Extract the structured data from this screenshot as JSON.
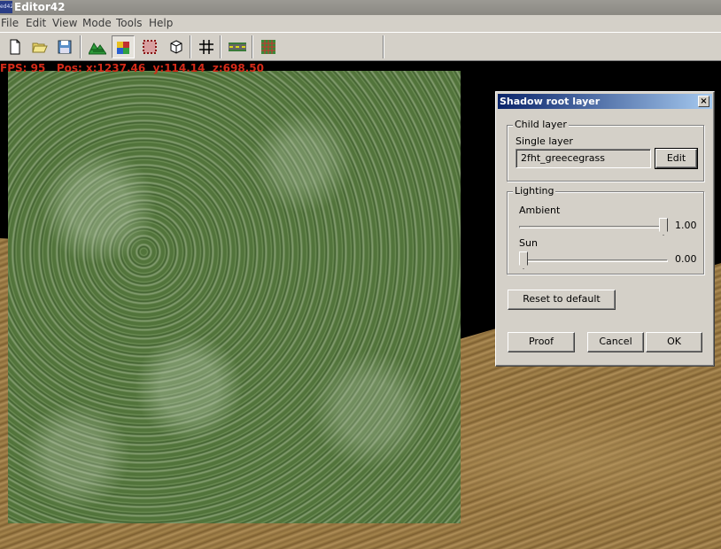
{
  "window": {
    "app_icon_text": "ed42",
    "title": "Editor42"
  },
  "menu": [
    "File",
    "Edit",
    "View",
    "Mode",
    "Tools",
    "Help"
  ],
  "toolbar": [
    {
      "icon": "new-file-icon"
    },
    {
      "icon": "open-folder-icon"
    },
    {
      "icon": "save-icon"
    },
    {
      "icon": "terrain-icon"
    },
    {
      "icon": "texture-layer-icon",
      "pressed": true
    },
    {
      "icon": "selection-icon"
    },
    {
      "icon": "cube-icon"
    },
    {
      "icon": "grid-icon"
    },
    {
      "icon": "road-icon"
    },
    {
      "icon": "texture-grid-icon"
    }
  ],
  "hud": {
    "fps_text": "FPS: 95",
    "pos_text": "Pos: x:1237.46  y:114.14  z:698.50"
  },
  "dialog": {
    "title": "Shadow root layer",
    "child_layer": {
      "group_label": "Child layer",
      "type_label": "Single layer",
      "layer_name": "2fht_greecegrass",
      "edit_label": "Edit"
    },
    "lighting": {
      "group_label": "Lighting",
      "ambient": {
        "label": "Ambient",
        "value": 1.0,
        "value_text": "1.00"
      },
      "sun": {
        "label": "Sun",
        "value": 0.0,
        "value_text": "0.00"
      }
    },
    "reset_label": "Reset to default",
    "proof_label": "Proof",
    "cancel_label": "Cancel",
    "ok_label": "OK"
  }
}
